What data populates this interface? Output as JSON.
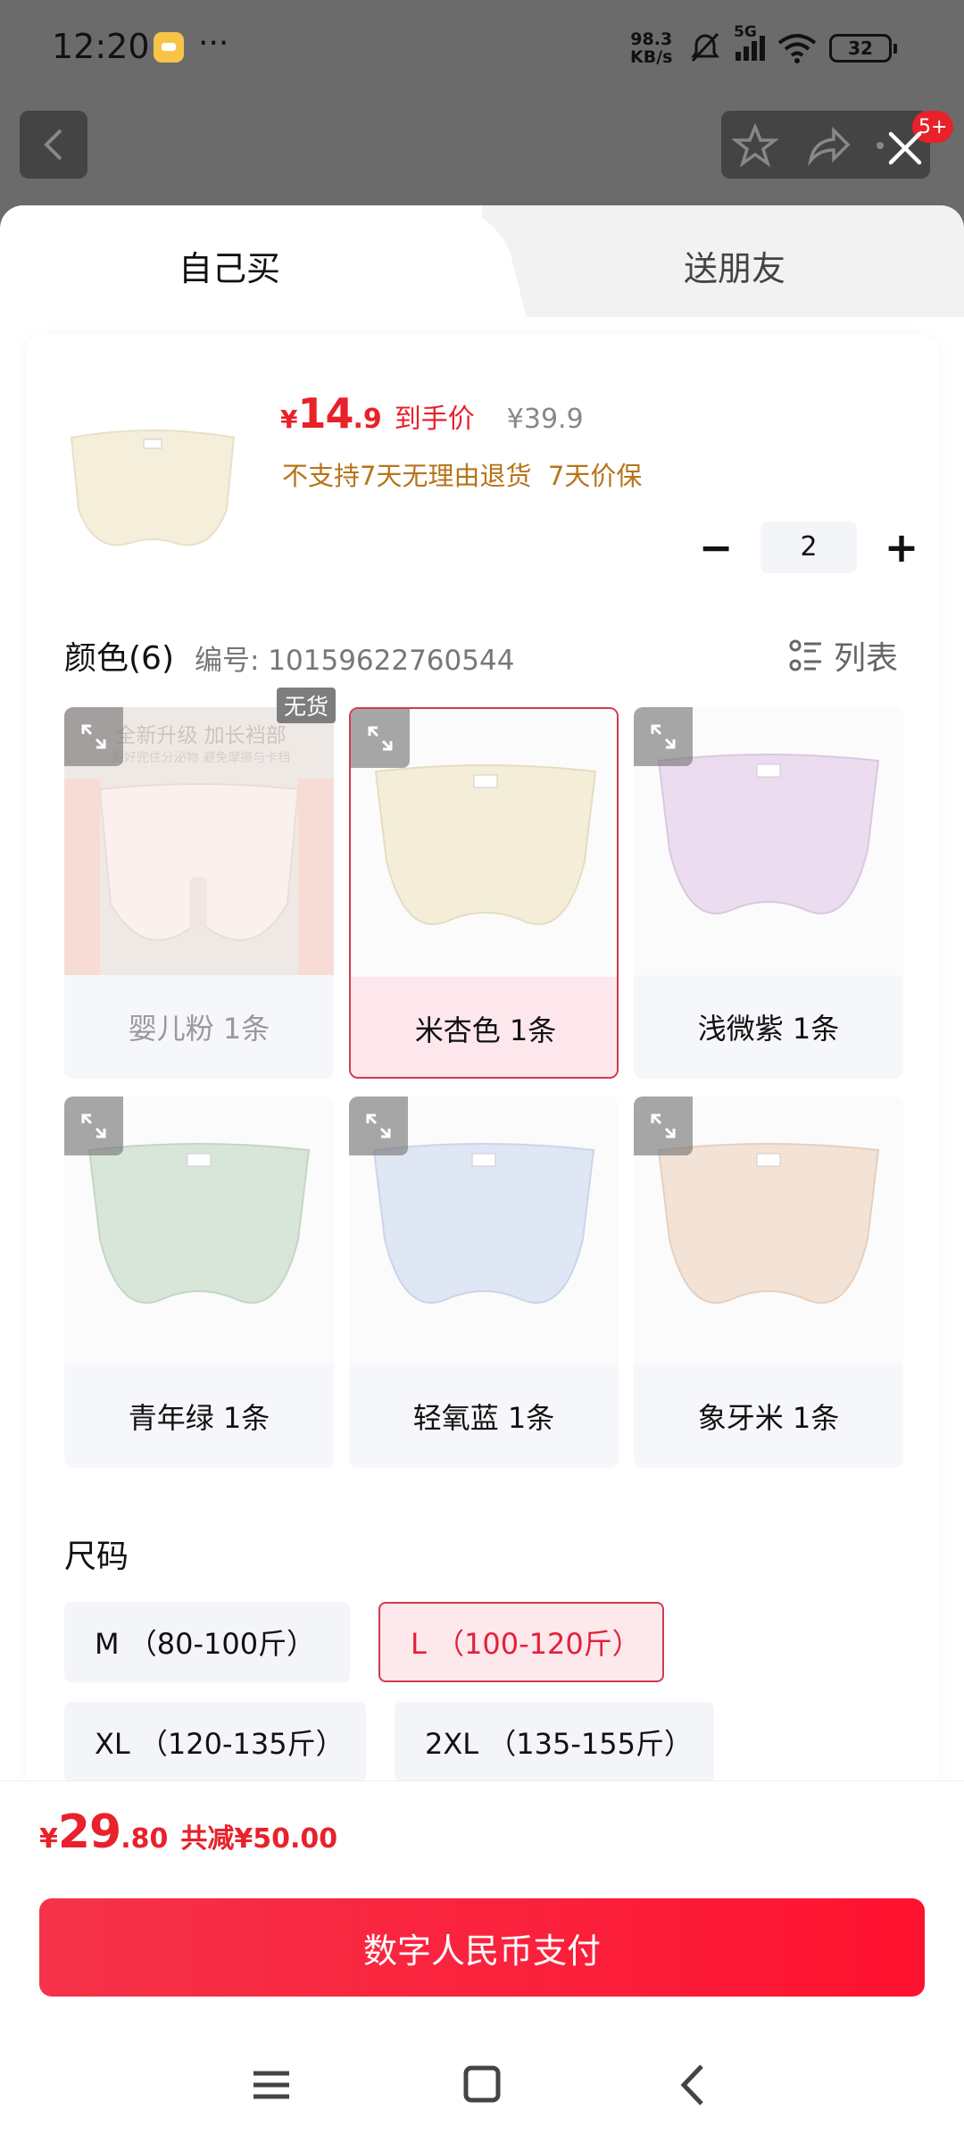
{
  "status": {
    "time": "12:20",
    "dots": "···",
    "speed": "98.3\nKB/s",
    "network": "5G",
    "battery": "32"
  },
  "header": {
    "badge": "5+"
  },
  "tabs": {
    "self": "自己买",
    "gift": "送朋友"
  },
  "product": {
    "price_symbol": "¥",
    "price_int": "14",
    "price_dec": ".9",
    "price_note": "到手价",
    "original_price": "¥39.9",
    "services": "不支持7天无理由退货  7天价保",
    "quantity": "2",
    "minus": "−",
    "plus": "+"
  },
  "color": {
    "title": "颜色(6)",
    "sku": "编号: 10159622760544",
    "list_label": "列表",
    "out_of_stock": "无货",
    "promo_line1": "全新升级 加长裆部",
    "promo_line2": "更好兜住分泌物 避免摩擦与卡档",
    "items": [
      "婴儿粉 1条",
      "米杏色 1条",
      "浅微紫 1条",
      "青年绿 1条",
      "轻氧蓝 1条",
      "象牙米 1条"
    ]
  },
  "size": {
    "title": "尺码",
    "options": [
      "M （80-100斤）",
      "L （100-120斤）",
      "XL （120-135斤）",
      "2XL （135-155斤）"
    ]
  },
  "footer": {
    "total_symbol": "¥",
    "total_int": "29",
    "total_dec": ".80",
    "savings": "共减¥50.00",
    "pay_button": "数字人民币支付"
  },
  "colors": {
    "accent": "#e8212b",
    "selected_border": "#cf3b52",
    "service_text": "#b8741a"
  }
}
